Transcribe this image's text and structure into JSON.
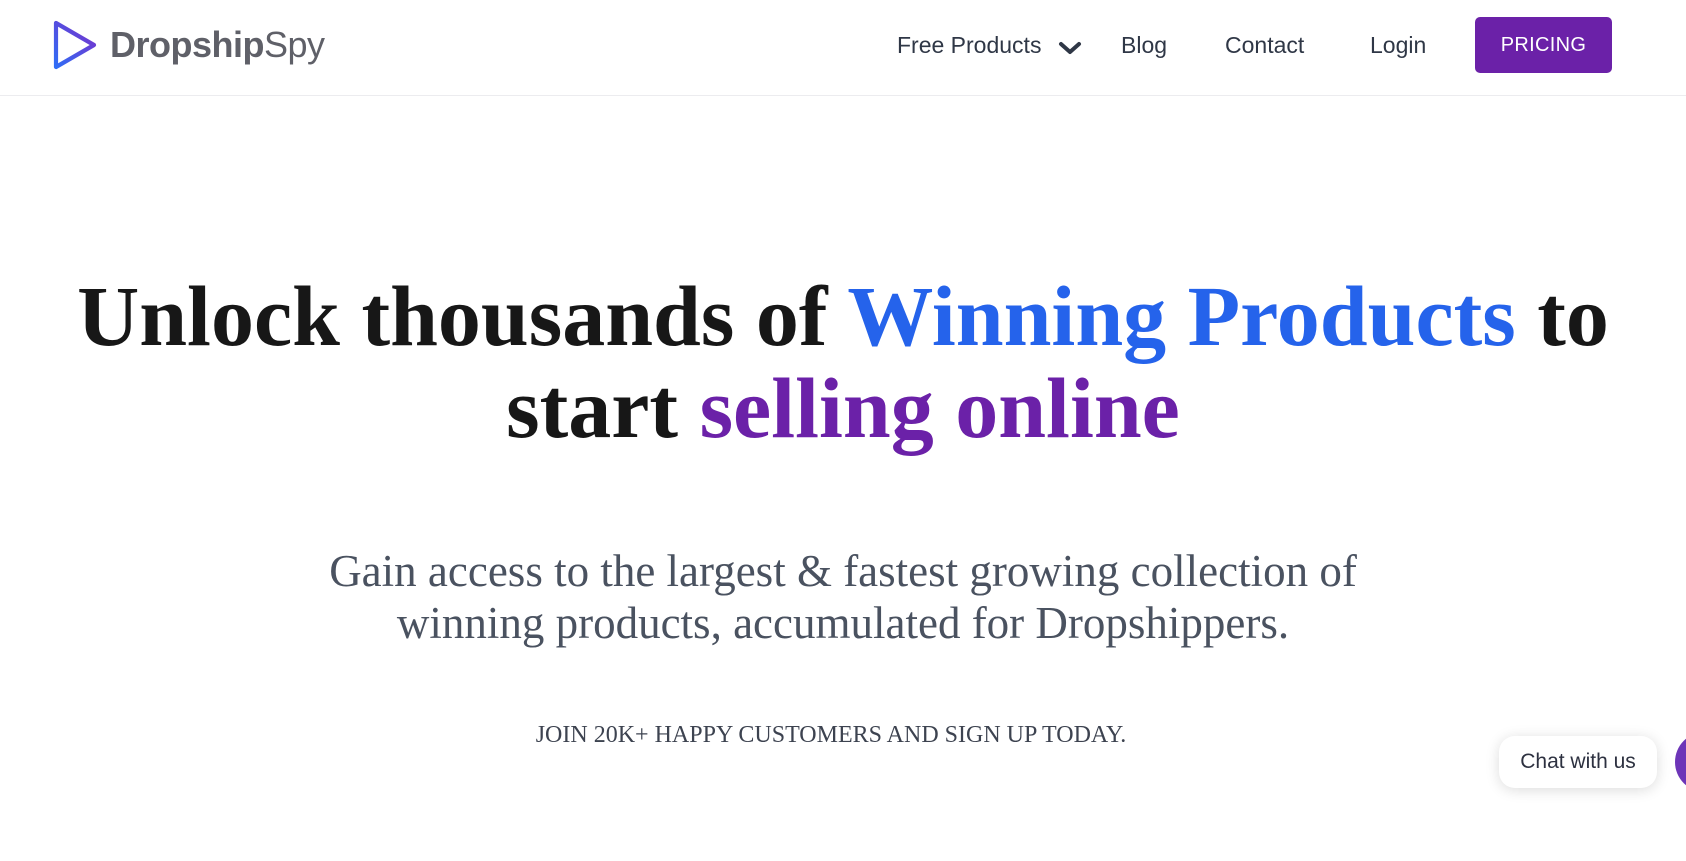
{
  "brand": {
    "name_bold": "Dropship",
    "name_light": "Spy",
    "logo_icon": "play-triangle-icon",
    "colors": {
      "gradient_start": "#2f6df6",
      "gradient_end": "#7b2fc9"
    }
  },
  "nav": {
    "items": [
      {
        "label": "Free Products",
        "icon": "chevron-down-icon"
      },
      {
        "label": "Blog"
      },
      {
        "label": "Contact"
      },
      {
        "label": "Login"
      }
    ],
    "cta_label": "PRICING"
  },
  "hero": {
    "title_parts": {
      "a": "Unlock thousands of ",
      "b": "Winning Products",
      "c": " to start ",
      "d": "selling online"
    },
    "subtitle": "Gain access to the largest & fastest growing collection of winning products, accumulated for Dropshippers.",
    "cta_text": "JOIN 20K+ HAPPY CUSTOMERS AND SIGN UP TODAY."
  },
  "chat": {
    "label": "Chat with us",
    "launcher_icon": "chat-launcher-icon"
  },
  "colors": {
    "accent_purple": "#6b21a8",
    "accent_blue": "#2563eb",
    "heading_text": "#171717",
    "body_text": "#4a5260"
  }
}
